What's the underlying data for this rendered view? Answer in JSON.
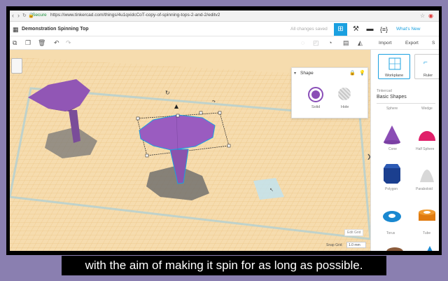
{
  "browser": {
    "secure_label": "Secure",
    "url": "https://www.tinkercad.com/things/4u1qxidcCoT-copy-of-spinning-tops-2-and-2/editv2"
  },
  "app": {
    "title": "Demonstration Spinning Top",
    "save_status": "All changes saved",
    "whats_new": "What's New"
  },
  "toolbar": {
    "import_label": "Import",
    "export_label": "Export",
    "share_label": "S"
  },
  "shape_panel": {
    "title": "Shape",
    "solid_label": "Solid",
    "hole_label": "Hole",
    "solid_color": "#8b4db5"
  },
  "viewport": {
    "edit_grid_label": "Edit Grid",
    "snap_grid_label": "Snap Grid",
    "snap_grid_value": "1.0 mm"
  },
  "sidebar": {
    "workplane_label": "Workplane",
    "ruler_label": "Ruler",
    "library_small": "Tinkercad",
    "library_name": "Basic Shapes",
    "shapes_top": [
      "Sphere",
      "Wedge"
    ],
    "shapes": [
      {
        "name": "Cone",
        "color": "#8b4db5"
      },
      {
        "name": "Half Sphere",
        "color": "#e0206a"
      },
      {
        "name": "Polygon",
        "color": "#1b3f8f"
      },
      {
        "name": "Paraboloid",
        "color": "#d8d8d8"
      },
      {
        "name": "Torus",
        "color": "#1a88d0"
      },
      {
        "name": "Tube",
        "color": "#e07b10"
      }
    ]
  },
  "caption": "with the aim of making it spin for as long as possible."
}
